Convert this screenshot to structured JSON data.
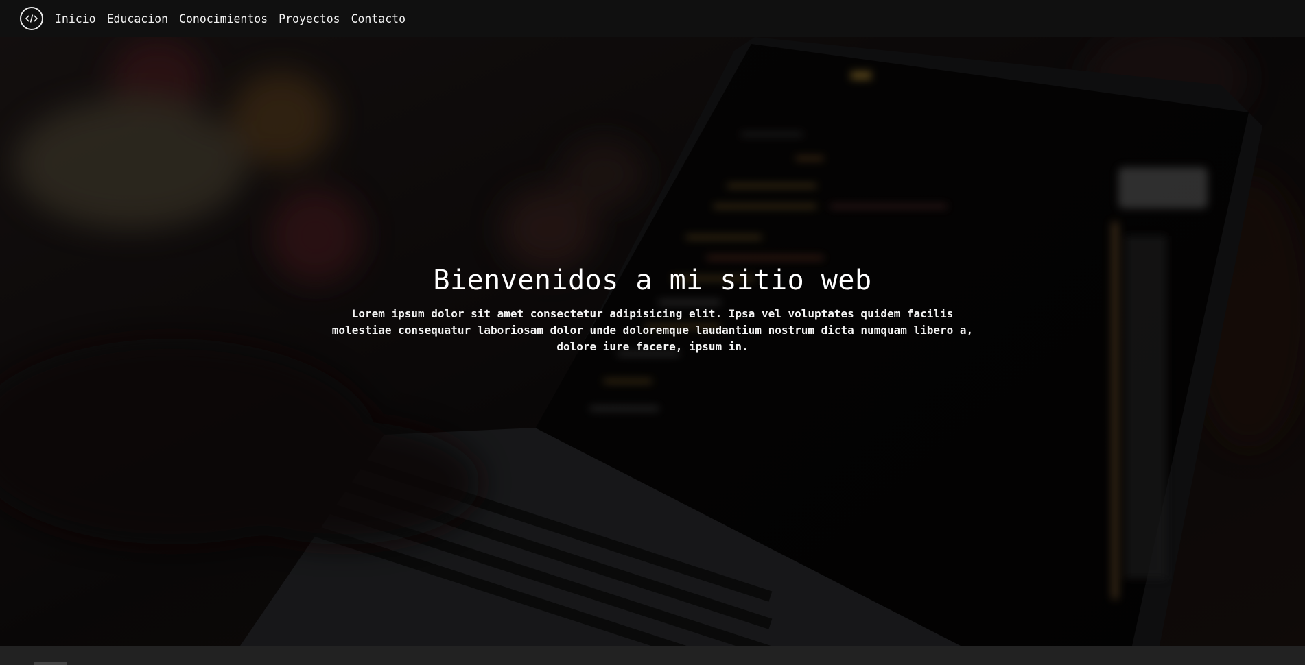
{
  "nav": {
    "logo_icon": "code-brackets-icon",
    "links": [
      "Inicio",
      "Educacion",
      "Conocimientos",
      "Proyectos",
      "Contacto"
    ]
  },
  "hero": {
    "title": "Bienvenidos a mi sitio web",
    "text": "Lorem ipsum dolor sit amet consectetur adipisicing elit. Ipsa vel voluptates quidem facilis molestiae consequatur laboriosam dolor unde doloremque laudantium nostrum dicta numquam libero a, dolore iure facere, ipsum in."
  },
  "colors": {
    "navbar_bg": "#101010",
    "text": "#ffffff",
    "overlay": "#000000"
  }
}
